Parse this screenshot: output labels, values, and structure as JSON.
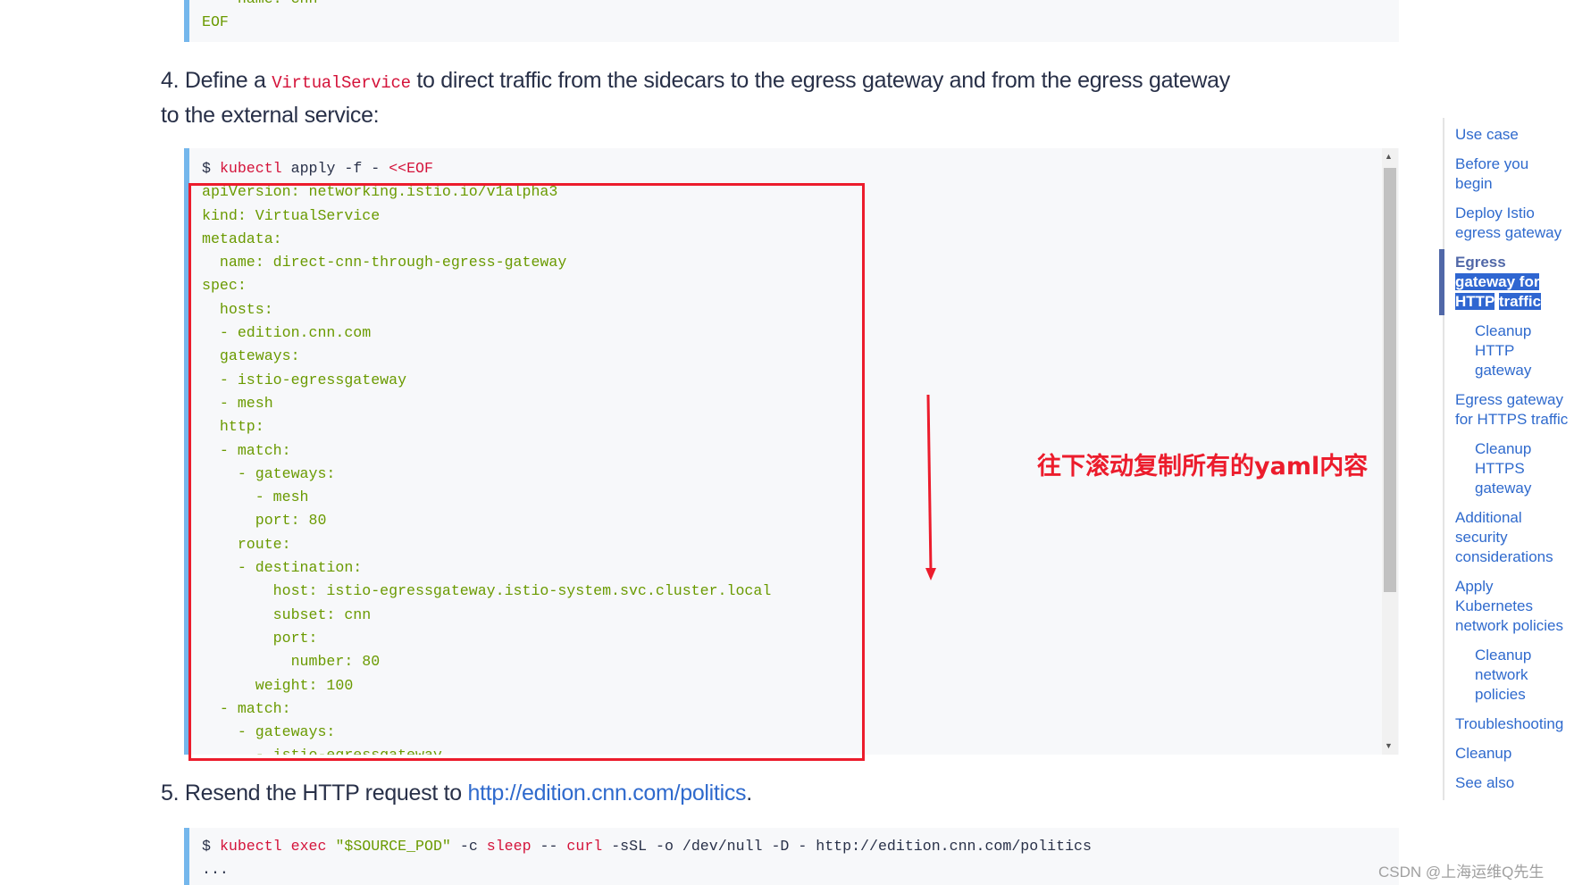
{
  "prev_code": {
    "lines": [
      "  - name: cnn",
      "EOF"
    ]
  },
  "step4": {
    "number": "4.",
    "text_before": "Define a",
    "code": "VirtualService",
    "text_after": "to direct traffic from the sidecars to the egress gateway and from the egress gateway to the external",
    "text_line2": "service:"
  },
  "code4": {
    "prompt": "$",
    "cmd": "kubectl",
    "args": "apply -f -",
    "heredoc": "<<EOF",
    "lines": [
      "apiVersion: networking.istio.io/v1alpha3",
      "kind: VirtualService",
      "metadata:",
      "  name: direct-cnn-through-egress-gateway",
      "spec:",
      "  hosts:",
      "  - edition.cnn.com",
      "  gateways:",
      "  - istio-egressgateway",
      "  - mesh",
      "  http:",
      "  - match:",
      "    - gateways:",
      "      - mesh",
      "      port: 80",
      "    route:",
      "    - destination:",
      "        host: istio-egressgateway.istio-system.svc.cluster.local",
      "        subset: cnn",
      "        port:",
      "          number: 80",
      "      weight: 100",
      "  - match:",
      "    - gateways:",
      "      - istio-egressgateway"
    ]
  },
  "annotation": {
    "text": "往下滚动复制所有的yaml内容",
    "color": "#ec1c2c"
  },
  "step5": {
    "number": "5.",
    "text_before": "Resend the HTTP request to",
    "link": "http://edition.cnn.com/politics",
    "text_after": "."
  },
  "code5": {
    "prompt": "$",
    "kubectl": "kubectl",
    "exec": "exec",
    "pod": "\"$SOURCE_POD\"",
    "c": "-c",
    "sleep": "sleep",
    "dd": "--",
    "curl": "curl",
    "rest": "-sSL -o /dev/null -D - http://edition.cnn.com/politics",
    "line2": "..."
  },
  "toc": {
    "items": [
      {
        "label": "Use case"
      },
      {
        "label": "Before you begin"
      },
      {
        "label": "Deploy Istio egress gateway"
      },
      {
        "label_a": "Egress",
        "label_b": "gateway for HTTP",
        "label_c": "traffic",
        "active": true
      },
      {
        "label": "Cleanup HTTP gateway"
      },
      {
        "label": "Egress gateway for HTTPS",
        "label2": "traffic"
      },
      {
        "label": "Cleanup HTTPS",
        "label2": "gateway"
      },
      {
        "label": "Additional security",
        "label2": "considerations"
      },
      {
        "label": "Apply Kubernetes network",
        "label2": "policies"
      },
      {
        "label": "Cleanup network",
        "label2": "policies"
      },
      {
        "label": "Troubleshooting"
      },
      {
        "label": "Cleanup"
      },
      {
        "label": "See also"
      }
    ]
  },
  "watermark": "CSDN @上海运维Q先生"
}
